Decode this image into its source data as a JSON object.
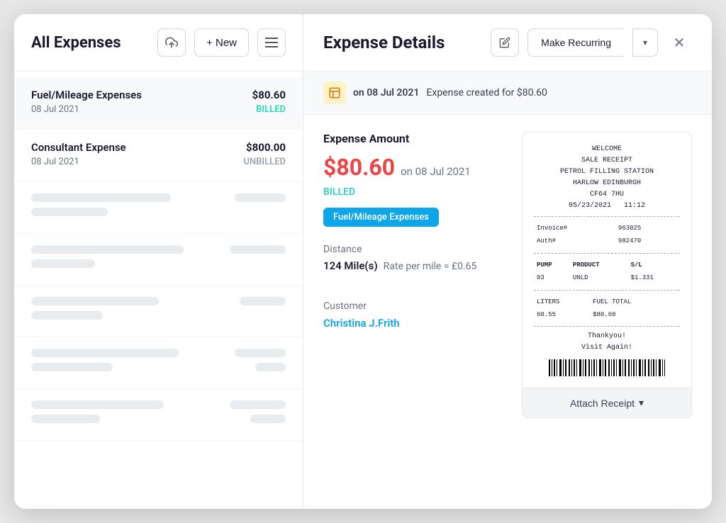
{
  "left_panel": {
    "title": "All Expenses",
    "upload_btn_label": "↑",
    "new_btn_label": "+ New",
    "menu_btn_label": "≡",
    "expense_items": [
      {
        "name": "Fuel/Mileage Expenses",
        "date": "08 Jul 2021",
        "amount": "$80.60",
        "status": "BILLED",
        "status_type": "billed",
        "active": true
      },
      {
        "name": "Consultant Expense",
        "date": "08 Jul 2021",
        "amount": "$800.00",
        "status": "UNBILLED",
        "status_type": "unbilled",
        "active": false
      }
    ]
  },
  "right_panel": {
    "title": "Expense Details",
    "edit_icon": "✏",
    "make_recurring_label": "Make Recurring",
    "dropdown_icon": "▾",
    "close_icon": "✕",
    "activity_banner": {
      "icon": "📋",
      "date": "on 08 Jul 2021",
      "text": "Expense created for $80.60"
    },
    "expense_amount_section": {
      "label": "Expense Amount",
      "amount": "$80.60",
      "date": "on 08 Jul 2021",
      "status": "BILLED",
      "category": "Fuel/Mileage Expenses"
    },
    "distance_section": {
      "label": "Distance",
      "value": "124 Mile(s)",
      "rate": "Rate per mile = £0.65"
    },
    "customer_section": {
      "label": "Customer",
      "name": "Christina J.Frith"
    },
    "receipt": {
      "line1": "WELCOME",
      "line2": "SALE RECEIPT",
      "line3": "PETROL FILLING STATION",
      "line4": "HARLOW EDINBURGH",
      "line5": "CF64 7HU",
      "date": "05/23/2021",
      "time": "11:12",
      "invoice_label": "Invoice#",
      "invoice_val": "963025",
      "auth_label": "Auth#",
      "auth_val": "982470",
      "col1": "PUMP",
      "col2": "PRODUCT",
      "col3": "S/L",
      "row1_pump": "03",
      "row1_product": "UNLD",
      "row1_price": "$1.331",
      "liters_label": "LITERS",
      "fuel_total_label": "FUEL TOTAL",
      "liters_val": "60.55",
      "fuel_total_val": "$80.60",
      "thanks": "Thankyou!",
      "visit": "Visit Again!",
      "attach_receipt_label": "Attach Receipt"
    }
  }
}
